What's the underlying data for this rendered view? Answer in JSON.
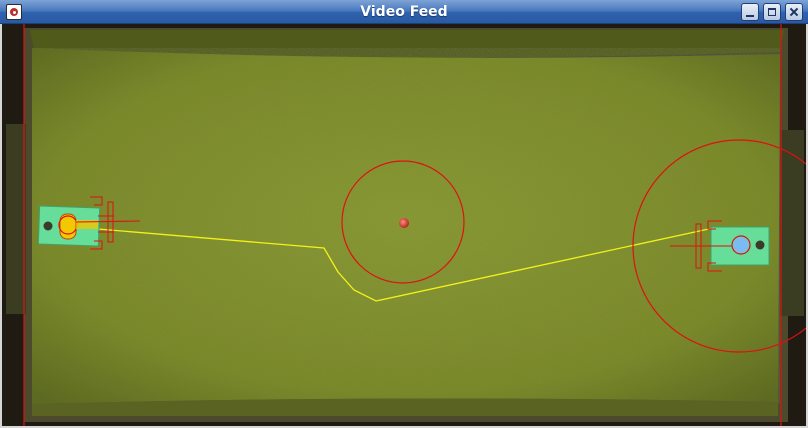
{
  "window": {
    "title": "Video Feed",
    "buttons": {
      "minimize": "minimize",
      "maximize": "maximize",
      "close": "close"
    }
  },
  "colors": {
    "titlebar": "#3b6cb5",
    "field": "#7f8f30",
    "field_dark": "#6b7a26",
    "overlay_red": "#e01010",
    "path_yellow": "#f2f21a",
    "robot_marker": "#66dd99",
    "ball": "#d9372d",
    "robot_left_accent": "#f5d400",
    "robot_right_accent": "#4aa0ff"
  },
  "icons": [
    "app-icon",
    "minimize-icon",
    "maximize-icon",
    "close-icon"
  ]
}
